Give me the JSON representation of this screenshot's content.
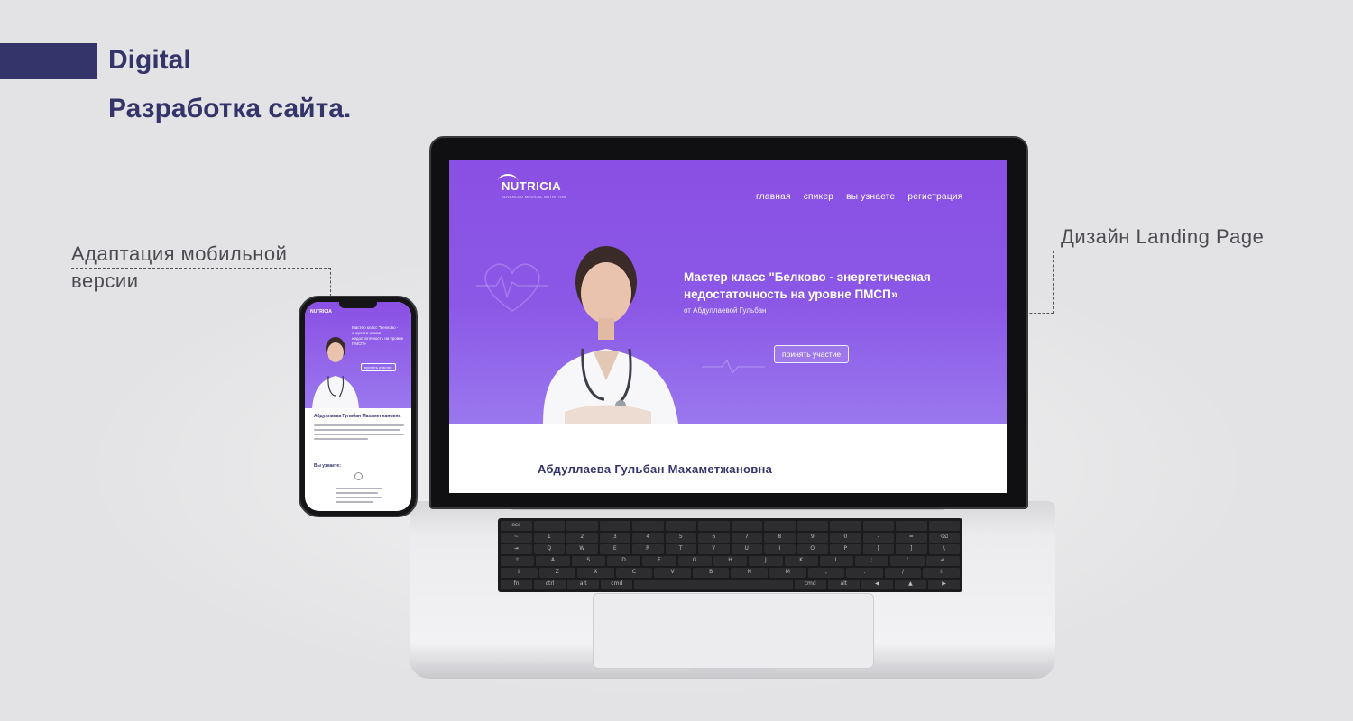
{
  "header": {
    "title": "Digital",
    "subtitle": "Разработка сайта."
  },
  "annotations": {
    "mobile_line1": "Адаптация мобильной",
    "mobile_line2": "версии",
    "landing": "Дизайн Landing Page"
  },
  "site": {
    "logo": "NUTRICIA",
    "logo_tagline": "ADVANCED MEDICAL NUTRITION",
    "nav": [
      "главная",
      "спикер",
      "вы узнаете",
      "регистрация"
    ],
    "hero_title": "Мастер класс \"Белково - энергетическая недостаточность на уровне ПМСП»",
    "hero_by": "от Абдуллаевой Гульбан",
    "cta": "принять участие",
    "speaker_name": "Абдуллаева Гульбан Махаметжановна"
  },
  "mobile_site": {
    "logo": "NUTRICIA",
    "hero_title": "Мастер класс \"Белково - энергетическая недостаточность на уровне ПМСП»",
    "cta": "принять участие",
    "speaker_name": "Абдуллаева Гульбан Махаметжановна",
    "you_learn": "Вы узнаете:"
  },
  "keyboard_rows": [
    [
      "esc",
      "",
      "",
      "",
      "",
      "",
      "",
      "",
      "",
      "",
      "",
      "",
      "",
      ""
    ],
    [
      "~",
      "1",
      "2",
      "3",
      "4",
      "5",
      "6",
      "7",
      "8",
      "9",
      "0",
      "-",
      "=",
      "⌫"
    ],
    [
      "⇥",
      "Q",
      "W",
      "E",
      "R",
      "T",
      "Y",
      "U",
      "I",
      "O",
      "P",
      "[",
      "]",
      "\\"
    ],
    [
      "⇪",
      "A",
      "S",
      "D",
      "F",
      "G",
      "H",
      "J",
      "K",
      "L",
      ";",
      "'",
      "↵"
    ],
    [
      "⇧",
      "Z",
      "X",
      "C",
      "V",
      "B",
      "N",
      "M",
      ",",
      ".",
      "/",
      "⇧"
    ],
    [
      "fn",
      "ctrl",
      "alt",
      "cmd",
      "",
      "cmd",
      "alt",
      "◀",
      "▲",
      "▶"
    ]
  ],
  "colors": {
    "brand_navy": "#34336a",
    "hero_purple": "#8a4fe4",
    "background": "#e3e3e5"
  }
}
